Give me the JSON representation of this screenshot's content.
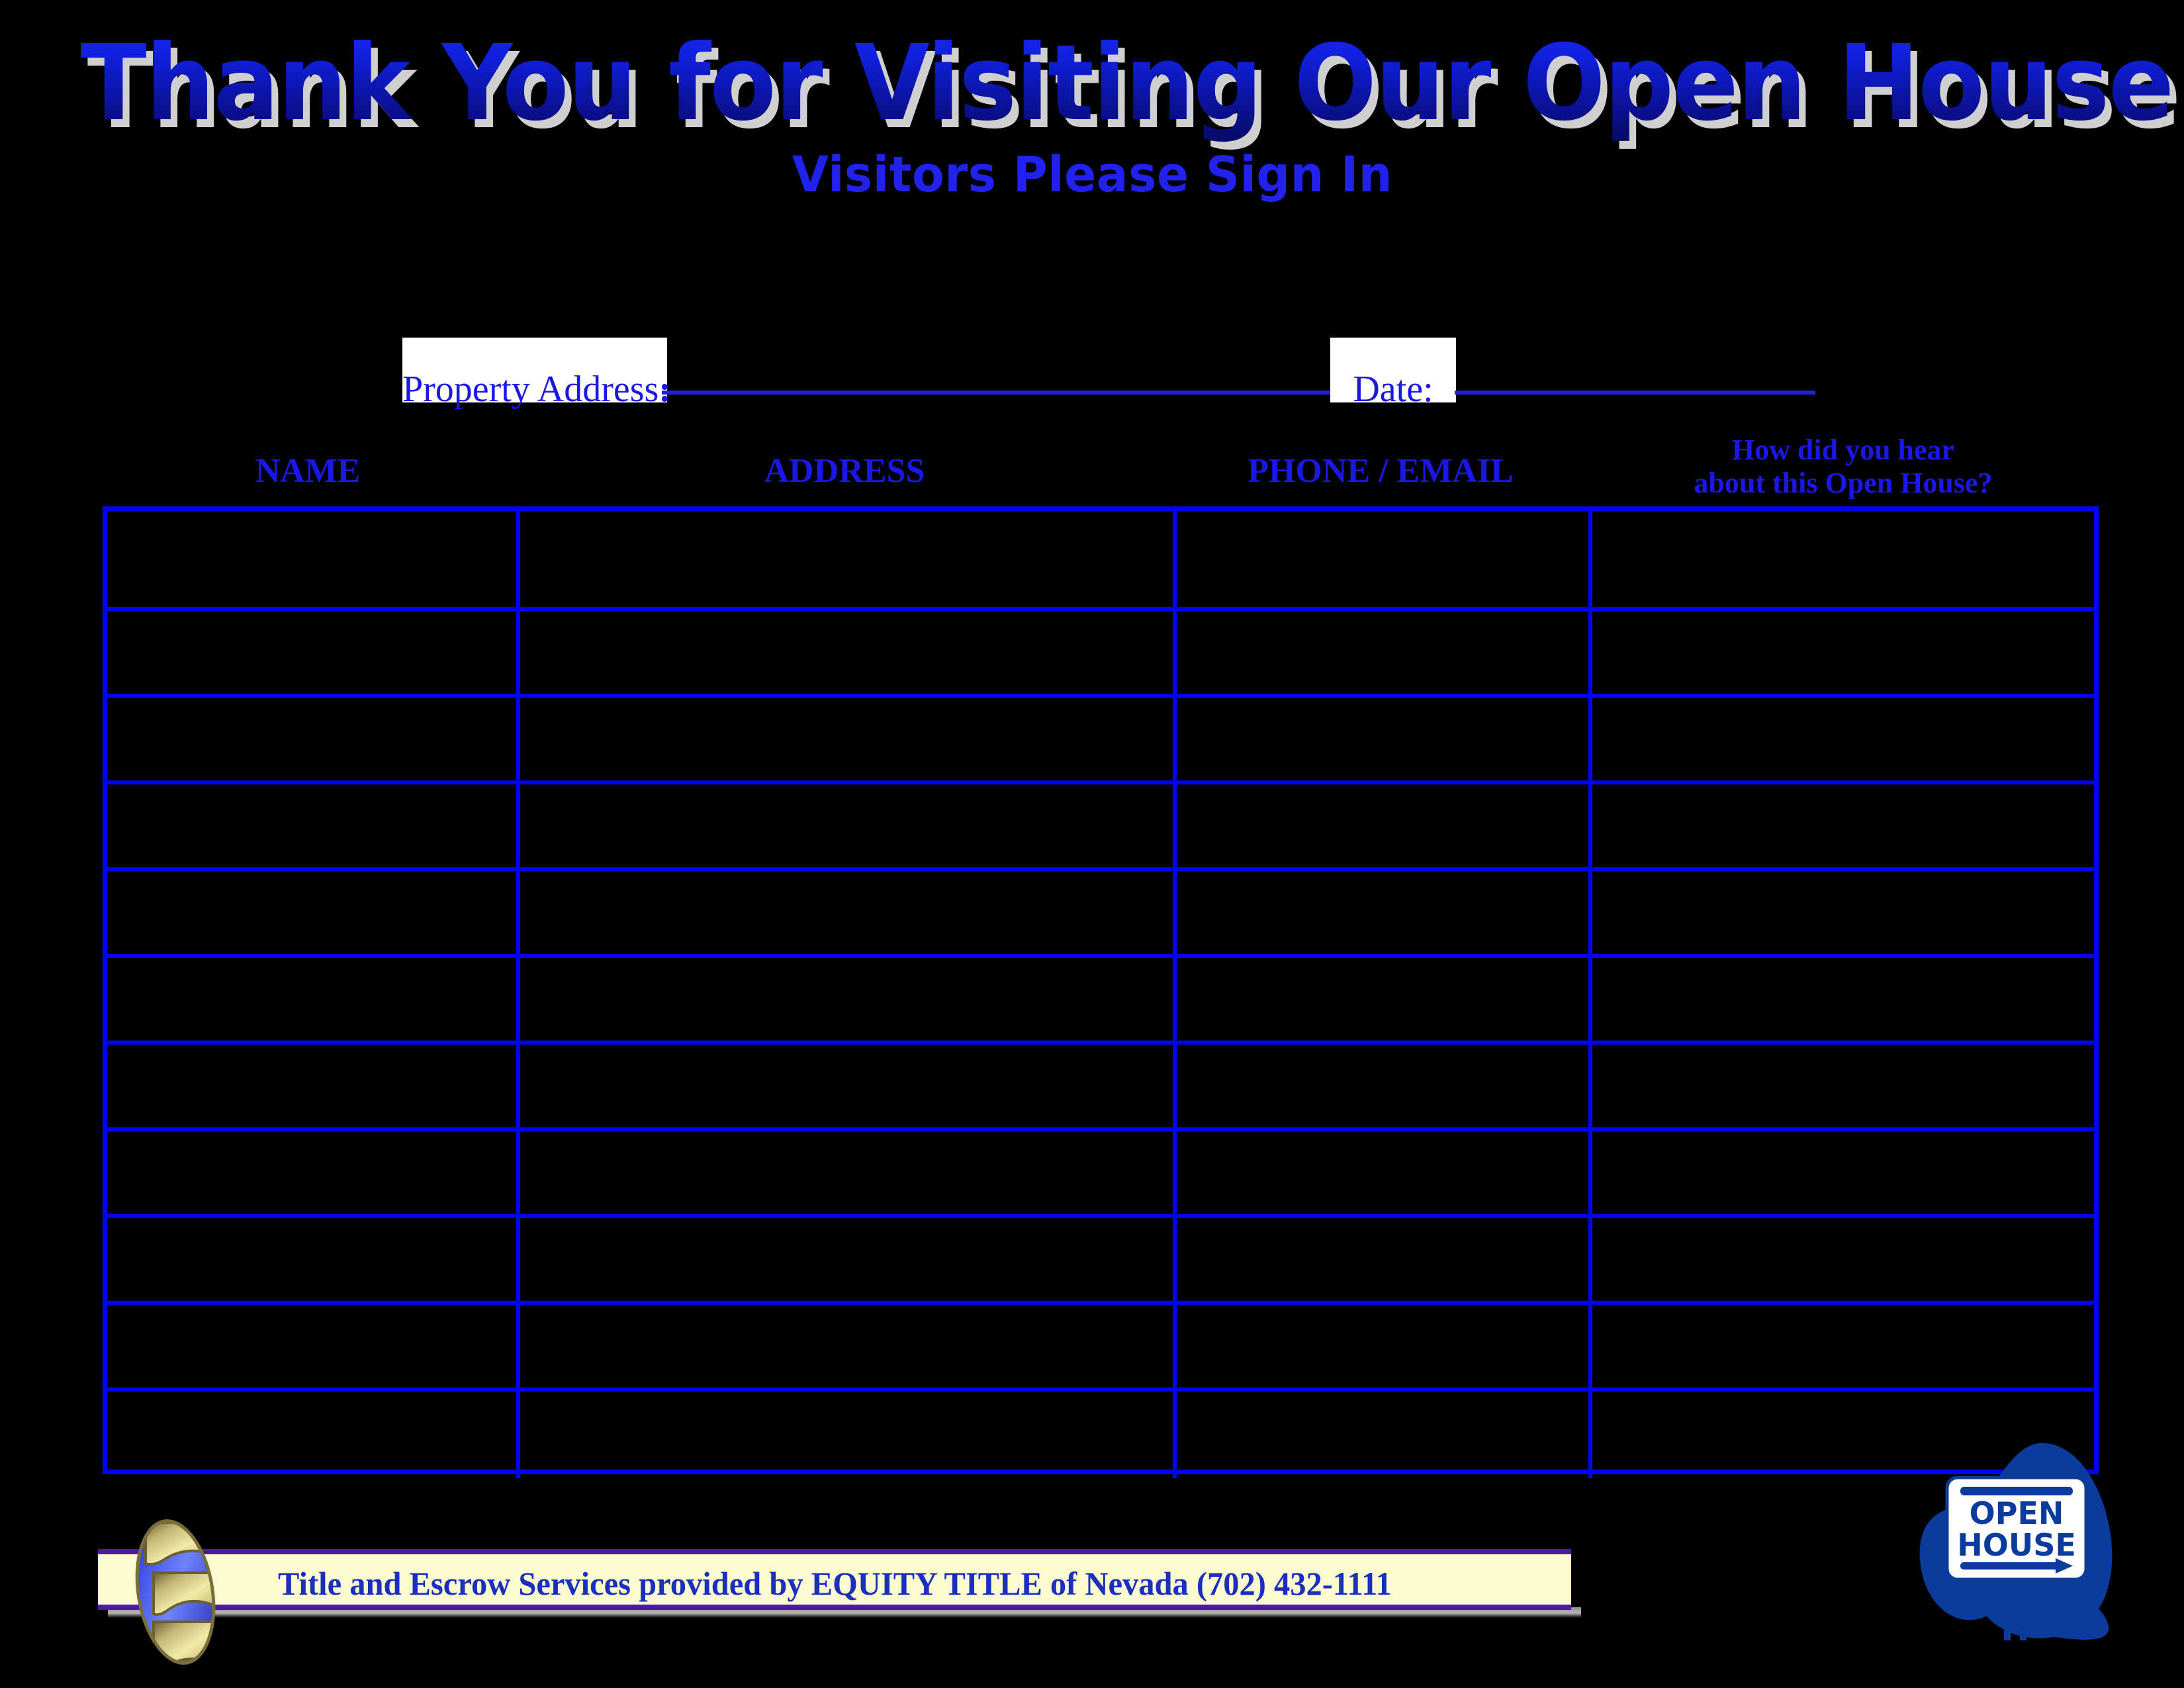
{
  "header": {
    "title": "Thank You for Visiting Our Open House!",
    "subtitle": "Visitors Please Sign In"
  },
  "meta_fields": {
    "property_address_label": "Property Address",
    "property_address_colon": ":",
    "property_address_value": "",
    "date_label": "Date:",
    "date_value": ""
  },
  "table": {
    "columns": [
      {
        "key": "name",
        "label": "NAME"
      },
      {
        "key": "address",
        "label": "ADDRESS"
      },
      {
        "key": "phone",
        "label": "PHONE / EMAIL"
      },
      {
        "key": "source",
        "label_line1": "How did you hear",
        "label_line2": "about this Open House?"
      }
    ],
    "row_count": 11,
    "rows": [
      {
        "name": "",
        "address": "",
        "phone": "",
        "source": ""
      },
      {
        "name": "",
        "address": "",
        "phone": "",
        "source": ""
      },
      {
        "name": "",
        "address": "",
        "phone": "",
        "source": ""
      },
      {
        "name": "",
        "address": "",
        "phone": "",
        "source": ""
      },
      {
        "name": "",
        "address": "",
        "phone": "",
        "source": ""
      },
      {
        "name": "",
        "address": "",
        "phone": "",
        "source": ""
      },
      {
        "name": "",
        "address": "",
        "phone": "",
        "source": ""
      },
      {
        "name": "",
        "address": "",
        "phone": "",
        "source": ""
      },
      {
        "name": "",
        "address": "",
        "phone": "",
        "source": ""
      },
      {
        "name": "",
        "address": "",
        "phone": "",
        "source": ""
      },
      {
        "name": "",
        "address": "",
        "phone": "",
        "source": ""
      }
    ]
  },
  "footer": {
    "text": "Title and Escrow Services provided by EQUITY TITLE of Nevada   (702) 432-1111",
    "company": "EQUITY TITLE of Nevada",
    "phone": "(702) 432-1111",
    "logo_name": "equity-title-logo"
  },
  "open_house_sign": {
    "line1": "OPEN",
    "line2": "HOUSE",
    "arrow": "right-arrow"
  },
  "colors": {
    "background": "#000000",
    "title_blue_light": "#1A28F2",
    "title_blue_dark": "#060A62",
    "title_shadow": "#CFCFCF",
    "subtitle_blue": "#2222EE",
    "label_blue": "#1A17E8",
    "grid_blue": "#0000FF",
    "rule_blue": "#2222DD",
    "footer_fill": "#FCFACF",
    "footer_border": "#4B18A8",
    "footer_text": "#1A2FBE",
    "sign_blue": "#0B3C9B",
    "logo_gold": "#E6D88A"
  }
}
